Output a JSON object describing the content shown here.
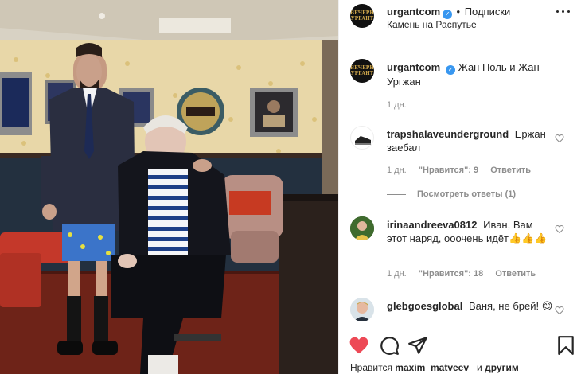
{
  "post": {
    "author": "urgantcom",
    "follow_label": "Подписки",
    "location": "Камень на Распутье",
    "caption": "Жан Поль и Жан Ургжан",
    "caption_age": "1 дн."
  },
  "comments": [
    {
      "username": "trapshalaveunderground",
      "text": "Ержан заебал",
      "age": "1 дн.",
      "likes": "\"Нравится\": 9",
      "reply": "Ответить",
      "view_replies": "Посмотреть ответы (1)"
    },
    {
      "username": "irinaandreeva0812",
      "text": "Иван, Вам этот наряд, ооочень идёт👍👍👍",
      "age": "1 дн.",
      "likes": "\"Нравится\": 18",
      "reply": "Ответить"
    },
    {
      "username": "glebgoesglobal",
      "text": "Ваня, не брей! 😊"
    }
  ],
  "footer": {
    "likes_prefix": "Нравится",
    "liked_by": "maxim_matveev_",
    "likes_joiner": "и",
    "others": "другим"
  },
  "icons": {
    "like": "heart-icon",
    "comment": "comment-icon",
    "share": "share-icon",
    "save": "bookmark-icon",
    "more": "more-options-icon",
    "verified": "verified-badge-icon",
    "comment_like": "heart-outline-icon"
  },
  "colors": {
    "like_red": "#ed4956",
    "verified_blue": "#3897f0",
    "muted_text": "#8e8e8e"
  }
}
